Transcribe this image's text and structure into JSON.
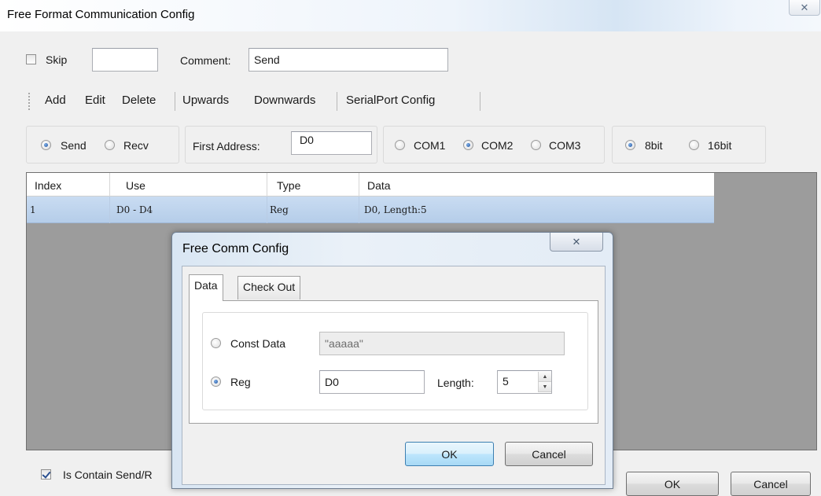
{
  "main": {
    "title": "Free Format Communication Config",
    "skip_label": "Skip",
    "comment_label": "Comment:",
    "comment_value": "Send",
    "toolbar": [
      "Add",
      "Edit",
      "Delete",
      "Upwards",
      "Downwards",
      "SerialPort Config"
    ],
    "direction": {
      "send_label": "Send",
      "recv_label": "Recv",
      "selected": "Send"
    },
    "first_address_label": "First Address:",
    "first_address_value": "D0",
    "ports": {
      "com1": "COM1",
      "com2": "COM2",
      "com3": "COM3",
      "selected": "COM2"
    },
    "bits": {
      "b8": "8bit",
      "b16": "16bit",
      "selected": "8bit"
    },
    "table": {
      "headers": {
        "index": "Index",
        "use": "Use",
        "type": "Type",
        "data": "Data"
      },
      "rows": [
        {
          "index": "1",
          "use": "D0 - D4",
          "type": "Reg",
          "data": "D0, Length:5"
        }
      ]
    },
    "contain_label": "Is Contain Send/R",
    "ok": "OK",
    "cancel": "Cancel"
  },
  "dialog": {
    "title": "Free Comm Config",
    "tabs": [
      "Data",
      "Check Out"
    ],
    "active_tab": "Data",
    "const_label": "Const Data",
    "const_value": "\"aaaaa\"",
    "reg_label": "Reg",
    "reg_value": "D0",
    "length_label": "Length:",
    "length_value": "5",
    "selected": "Reg",
    "ok": "OK",
    "cancel": "Cancel"
  },
  "icons": {
    "close": "close-icon",
    "spin_up": "spin-up-icon",
    "spin_down": "spin-down-icon"
  }
}
